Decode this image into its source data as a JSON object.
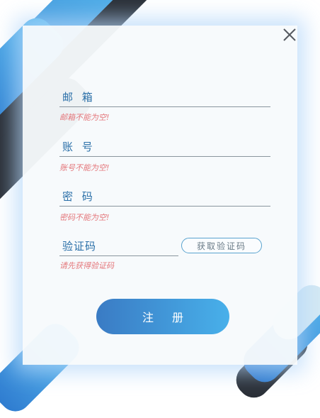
{
  "form": {
    "email": {
      "label": "邮 箱",
      "error": "邮箱不能为空!"
    },
    "account": {
      "label": "账 号",
      "error": "账号不能为空!"
    },
    "password": {
      "label": "密 码",
      "error": "密码不能为空!"
    },
    "code": {
      "label": "验证码",
      "error": "请先获得验证码",
      "get_button": "获取验证码"
    },
    "submit_label": "注册"
  },
  "icons": {
    "close": "close-icon"
  },
  "colors": {
    "accent": "#3a8fd6",
    "label": "#2a6fa8",
    "error": "#e4777b",
    "dark_stripe": "#2a2f37"
  }
}
